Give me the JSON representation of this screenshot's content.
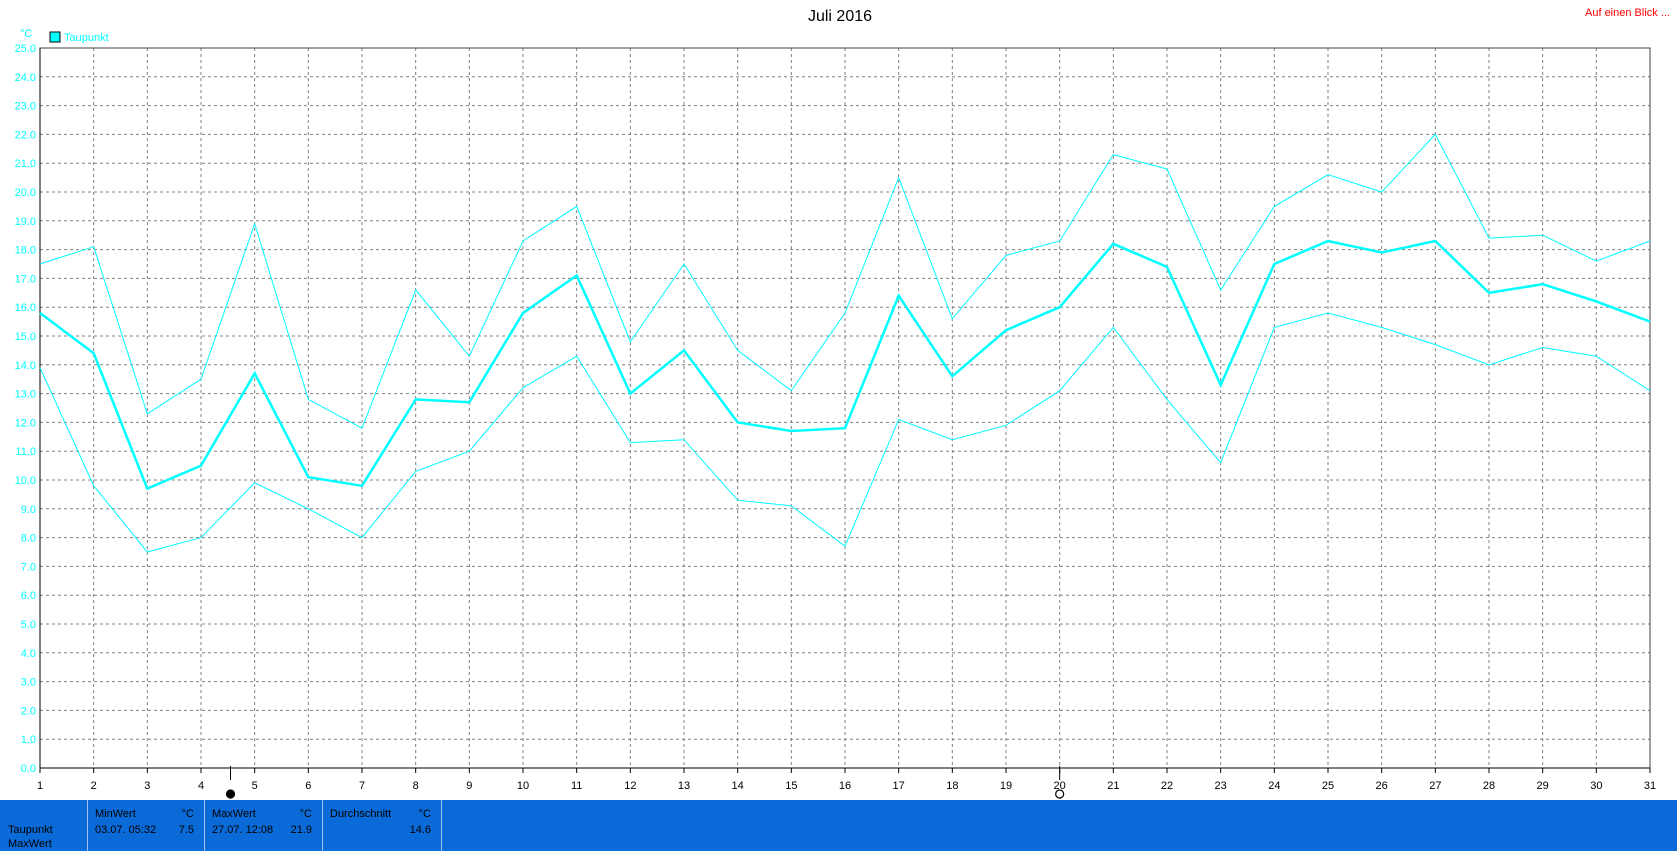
{
  "chart_data": {
    "type": "line",
    "title": "Juli 2016",
    "unit_label": "°C",
    "ylim": [
      0,
      25
    ],
    "y_ticks": [
      "0.0",
      "1.0",
      "2.0",
      "3.0",
      "4.0",
      "5.0",
      "6.0",
      "7.0",
      "8.0",
      "9.0",
      "10.0",
      "11.0",
      "12.0",
      "13.0",
      "14.0",
      "15.0",
      "16.0",
      "17.0",
      "18.0",
      "19.0",
      "20.0",
      "21.0",
      "22.0",
      "23.0",
      "24.0",
      "25.0"
    ],
    "x": [
      "1",
      "2",
      "3",
      "4",
      "5",
      "6",
      "7",
      "8",
      "9",
      "10",
      "11",
      "12",
      "13",
      "14",
      "15",
      "16",
      "17",
      "18",
      "19",
      "20",
      "21",
      "22",
      "23",
      "24",
      "25",
      "26",
      "27",
      "28",
      "29",
      "30",
      "31"
    ],
    "grid": true,
    "legend": {
      "label": "Taupunkt",
      "color": "#00ffff",
      "position": "top-left"
    },
    "series": [
      {
        "name": "Taupunkt",
        "role": "max",
        "values": [
          17.5,
          18.1,
          12.3,
          13.5,
          18.9,
          12.8,
          11.8,
          16.6,
          14.3,
          18.3,
          19.5,
          14.8,
          17.5,
          14.5,
          13.1,
          15.8,
          20.5,
          15.6,
          17.8,
          18.3,
          21.3,
          20.8,
          16.6,
          19.5,
          20.6,
          20.0,
          22.0,
          18.4,
          18.5,
          17.6,
          18.3
        ]
      },
      {
        "name": "Taupunkt",
        "role": "avg",
        "values": [
          15.8,
          14.4,
          9.7,
          10.5,
          13.7,
          10.1,
          9.8,
          12.8,
          12.7,
          15.8,
          17.1,
          13.0,
          14.5,
          12.0,
          11.7,
          11.8,
          16.4,
          13.6,
          15.2,
          16.0,
          18.2,
          17.4,
          13.3,
          17.5,
          18.3,
          17.9,
          18.3,
          16.5,
          16.8,
          16.2,
          15.5
        ]
      },
      {
        "name": "Taupunkt",
        "role": "min",
        "values": [
          13.9,
          9.8,
          7.5,
          8.0,
          9.9,
          9.0,
          8.0,
          10.3,
          11.0,
          13.2,
          14.3,
          11.3,
          11.4,
          9.3,
          9.1,
          7.7,
          12.1,
          11.4,
          11.9,
          13.1,
          15.3,
          12.8,
          10.6,
          15.3,
          15.8,
          15.3,
          14.7,
          14.0,
          14.6,
          14.3,
          13.1
        ]
      }
    ],
    "line_color": "#00ffff",
    "axis_color": "#00ffff",
    "grid_color": "#808080",
    "markers": [
      {
        "name": "filled-circle-marker",
        "day": 4.55
      },
      {
        "name": "open-circle-marker",
        "day": 20.0
      }
    ]
  },
  "header": {
    "link_text": "Auf einen Blick ...",
    "link_color": "#ff0000"
  },
  "footer": {
    "background": "#0a6ad8",
    "row_labels": [
      "Taupunkt",
      "MaxWert"
    ],
    "min": {
      "header": "MinWert",
      "unit": "°C",
      "time": "03.07.  05:32",
      "value": "7.5"
    },
    "max": {
      "header": "MaxWert",
      "unit": "°C",
      "time": "27.07.  12:08",
      "value": "21.9"
    },
    "avg": {
      "header": "Durchschnitt",
      "unit": "°C",
      "value": "14.6"
    }
  }
}
